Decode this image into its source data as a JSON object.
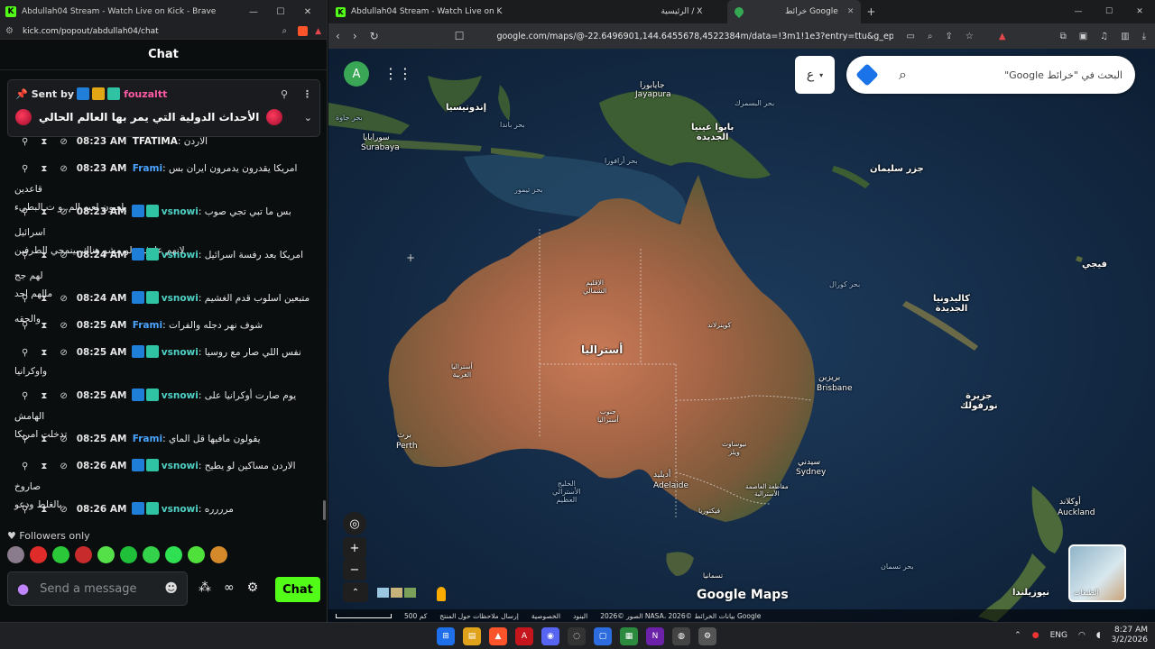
{
  "chat_window": {
    "title": "Abdullah04 Stream - Watch Live on Kick - Brave",
    "url": "kick.com/popout/abdullah04/chat",
    "header": "Chat",
    "pinned": {
      "sent_by_label": "Sent by",
      "user": "fouzaltt",
      "text": "الأحداث الدولية التي يمر بها العالم الحالي"
    },
    "messages": [
      {
        "time": "08:23 AM",
        "user": "TFATIMA",
        "color": "#f0f0f0",
        "text": "الاردن",
        "cont": "",
        "badges": 0
      },
      {
        "time": "08:23 AM",
        "user": "Frami",
        "color": "#4aa3ff",
        "text": "امريكا يقدرون يدمرون ايران بس قاعدين",
        "cont": "يلعبون لعبه الم. و ت البطيء",
        "badges": 0
      },
      {
        "time": "08:23 AM",
        "user": "vsnowi",
        "color": "#4fd1c5",
        "text": "بس ما تبي تجي صوب اسرائيل",
        "cont": "لانهم عارفين لو مشو هناك بينمحي الطرفين",
        "badges": 2
      },
      {
        "time": "08:24 AM",
        "user": "vsnowi",
        "color": "#4fd1c5",
        "text": "امريكا بعد رفسة اسرائيل لهم جج",
        "cont": "مالهم احد",
        "badges": 2
      },
      {
        "time": "08:24 AM",
        "user": "vsnowi",
        "color": "#4fd1c5",
        "text": "متبعين اسلوب قدم الغشيم والحقه",
        "cont": "",
        "badges": 2
      },
      {
        "time": "08:25 AM",
        "user": "Frami",
        "color": "#4aa3ff",
        "text": "شوف نهر دجله والفرات",
        "cont": "",
        "badges": 0
      },
      {
        "time": "08:25 AM",
        "user": "vsnowi",
        "color": "#4fd1c5",
        "text": "نفس اللي صار مع روسيا",
        "cont": "واوكرانيا",
        "badges": 2
      },
      {
        "time": "08:25 AM",
        "user": "vsnowi",
        "color": "#4fd1c5",
        "text": "يوم صارت أوكرانيا على الهامش",
        "cont": "تدخلت امريكا",
        "badges": 2
      },
      {
        "time": "08:25 AM",
        "user": "Frami",
        "color": "#4aa3ff",
        "text": "يقولون مافيها قل الماي",
        "cont": "",
        "badges": 0
      },
      {
        "time": "08:26 AM",
        "user": "vsnowi",
        "color": "#4fd1c5",
        "text": "الاردن مساكين لو يطيح صاروخ",
        "cont": "بالغلط ودعو",
        "badges": 2
      },
      {
        "time": "08:26 AM",
        "user": "vsnowi",
        "color": "#4fd1c5",
        "text": "مرررره",
        "cont": "",
        "badges": 2
      }
    ],
    "followers_only": "Followers only",
    "composer_placeholder": "Send a message",
    "chat_button": "Chat"
  },
  "browser": {
    "tabs": [
      {
        "label": "Abdullah04 Stream - Watch Live on K",
        "icon": "kick-icon"
      },
      {
        "label": "الرئيسية / X",
        "icon": "x-icon"
      },
      {
        "label": "خرائط Google",
        "icon": "maps-icon"
      }
    ],
    "url": "google.com/maps/@-22.6496901,144.6455678,4522384m/data=!3m1!1e3?entry=ttu&g_ep=Egoy..."
  },
  "map": {
    "search_placeholder": "البحث في \"خرائط Google\"",
    "lang_button": "ع",
    "avatar_letter": "A",
    "layers_label": "الطبقات",
    "logo": "Google Maps",
    "attribution": [
      "الصور ©2026 NASA، بيانات الخرائط ©2026 Google",
      "البنود",
      "الخصوصية",
      "إرسال ملاحظات حول المنتج",
      "500 كم"
    ],
    "labels": {
      "australia": "أستراليا",
      "indonesia": "إندونيسيا",
      "png": "بابوا غينيا\nالجديدة",
      "solomon": "جزر سليمان",
      "fiji": "فيجي",
      "new_caledonia": "كاليدونيا\nالجديدة",
      "norfolk": "جزيرة\nنورفولك",
      "nz": "نيوزيلندا",
      "jayapura_ar": "جايابورا",
      "jayapura": "Jayapura",
      "surabaya_ar": "سورابايا",
      "surabaya": "Surabaya",
      "perth_ar": "برث",
      "perth": "Perth",
      "adelaide_ar": "أديليد",
      "adelaide": "Adelaide",
      "sydney_ar": "سيدني",
      "sydney": "Sydney",
      "brisbane_ar": "بريزبن",
      "brisbane": "Brisbane",
      "auckland_ar": "أوكلاند",
      "auckland": "Auckland",
      "java_sea": "بحر جاوة",
      "banda_sea": "بحر باندا",
      "arafura": "بحر أرافورا",
      "timor": "بحر تيمور",
      "coral": "بحر كورال",
      "tasman": "بحر تسمان",
      "bismarck": "بحر البسمرك",
      "gab": "الخليج\nالأسترالي\nالعظيم",
      "wa": "أستراليا\nالغربية",
      "nt": "الإقليم\nالشمالي",
      "qld": "كوينزلاند",
      "sa": "جنوب\nأستراليا",
      "nsw": "نيوساوث\nويلز",
      "victoria": "فيكتوريا",
      "act": "مقاطعة العاصمة\nالأسترالية",
      "tasmania": "تسمانيا"
    }
  },
  "taskbar": {
    "lang": "ENG",
    "time": "8:27 AM",
    "date": "3/2/2026"
  }
}
